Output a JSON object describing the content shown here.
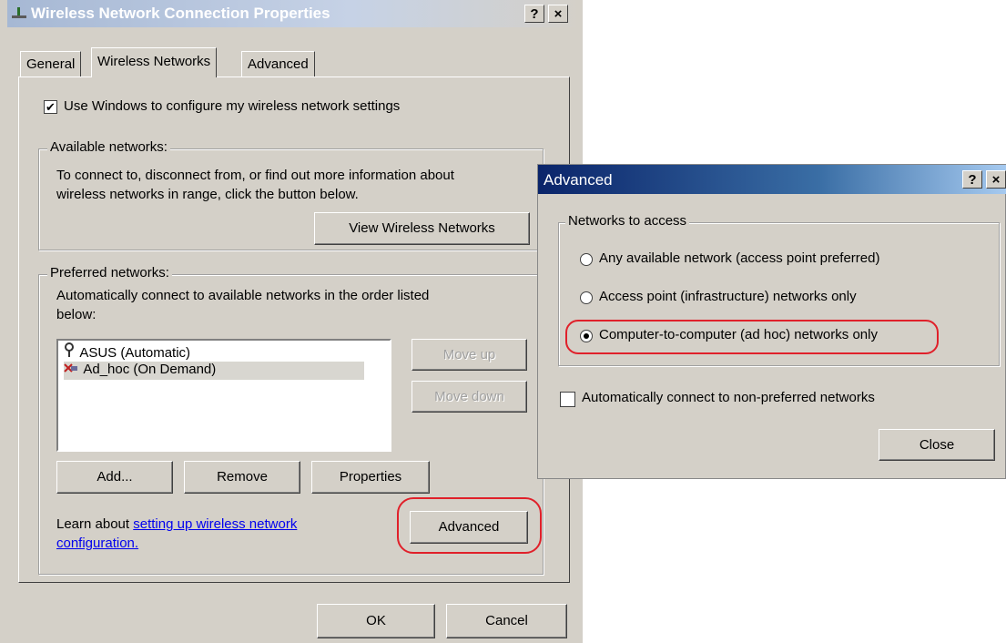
{
  "main_dialog": {
    "title": "Wireless Network Connection Properties",
    "help_label": "?",
    "close_label": "×",
    "tabs": [
      "General",
      "Wireless Networks",
      "Advanced"
    ],
    "use_windows_label": "Use Windows to configure my wireless network settings",
    "use_windows_checked": true,
    "check_mark": "✔",
    "available": {
      "label": "Available networks:",
      "text_line1": "To connect to, disconnect from, or find out more information about",
      "text_line2": "wireless networks in range, click the button below.",
      "view_button": "View Wireless Networks"
    },
    "preferred": {
      "label": "Preferred networks:",
      "text_line1": "Automatically connect to available networks in the order listed",
      "text_line2": "below:",
      "networks": [
        "ASUS (Automatic)",
        "Ad_hoc (On Demand)"
      ],
      "network_icons": [
        "antenna-icon",
        "adhoc-icon"
      ],
      "move_up": "Move up",
      "move_down": "Move down",
      "add": "Add...",
      "remove": "Remove",
      "properties": "Properties"
    },
    "learn_prefix": "Learn about ",
    "learn_link_line1": "setting up wireless network",
    "learn_link_line2": "configuration.",
    "advanced_button": "Advanced",
    "ok": "OK",
    "cancel": "Cancel"
  },
  "advanced_dialog": {
    "title": "Advanced",
    "help_label": "?",
    "close_label": "×",
    "group_label": "Networks to access",
    "options": [
      "Any available network (access point preferred)",
      "Access point (infrastructure) networks only",
      "Computer-to-computer (ad hoc) networks only"
    ],
    "selected_option": 2,
    "auto_connect_label": "Automatically connect to non-preferred networks",
    "auto_connect_checked": false,
    "close_button": "Close"
  },
  "colors": {
    "dialog_bg": "#d4d0c8",
    "highlight_red": "#e0202a",
    "link": "#0000ee"
  }
}
